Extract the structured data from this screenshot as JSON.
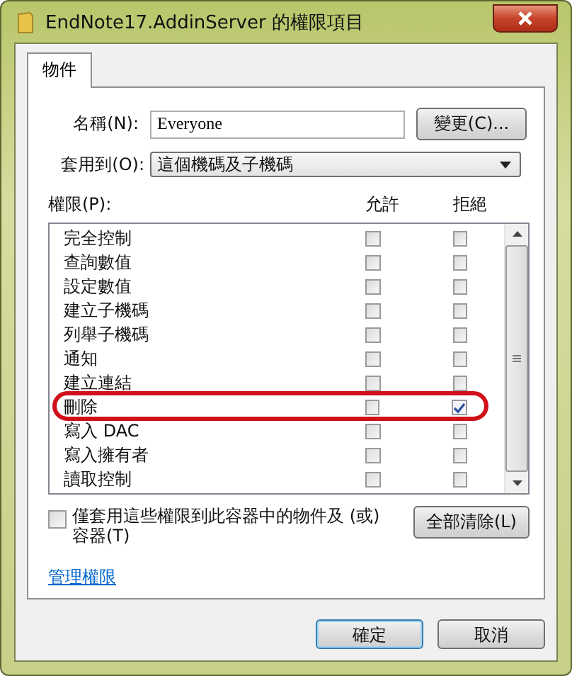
{
  "window": {
    "title": "EndNote17.AddinServer 的權限項目"
  },
  "tabs": [
    {
      "label": "物件",
      "selected": true
    }
  ],
  "name_field": {
    "label": "名稱(N):",
    "value": "Everyone",
    "button": "變更(C)..."
  },
  "apply_to": {
    "label": "套用到(O):",
    "value": "這個機碼及子機碼"
  },
  "permissions": {
    "label": "權限(P):",
    "columns": [
      "允許",
      "拒絕"
    ],
    "rows": [
      {
        "name": "完全控制",
        "allow": false,
        "deny": false,
        "highlighted": false
      },
      {
        "name": "查詢數值",
        "allow": false,
        "deny": false,
        "highlighted": false
      },
      {
        "name": "設定數值",
        "allow": false,
        "deny": false,
        "highlighted": false
      },
      {
        "name": "建立子機碼",
        "allow": false,
        "deny": false,
        "highlighted": false
      },
      {
        "name": "列舉子機碼",
        "allow": false,
        "deny": false,
        "highlighted": false
      },
      {
        "name": "通知",
        "allow": false,
        "deny": false,
        "highlighted": false
      },
      {
        "name": "建立連結",
        "allow": false,
        "deny": false,
        "highlighted": false
      },
      {
        "name": "刪除",
        "allow": false,
        "deny": true,
        "highlighted": true
      },
      {
        "name": "寫入 DAC",
        "allow": false,
        "deny": false,
        "highlighted": false
      },
      {
        "name": "寫入擁有者",
        "allow": false,
        "deny": false,
        "highlighted": false
      },
      {
        "name": "讀取控制",
        "allow": false,
        "deny": false,
        "highlighted": false
      }
    ]
  },
  "apply_only": {
    "label": "僅套用這些權限到此容器中的物件及 (或) 容器(T)",
    "checked": false
  },
  "clear_all_button": "全部清除(L)",
  "manage_link": "管理權限",
  "buttons": [
    {
      "label": "確定",
      "default": true
    },
    {
      "label": "取消",
      "default": false
    }
  ]
}
